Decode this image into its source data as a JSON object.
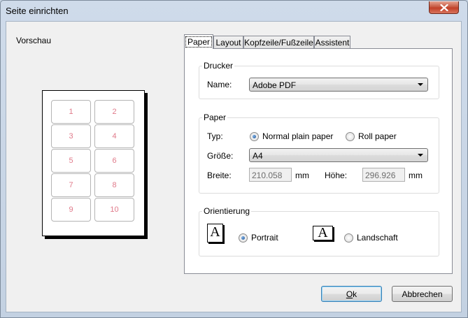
{
  "window": {
    "title": "Seite einrichten"
  },
  "preview": {
    "label": "Vorschau",
    "labels": [
      "1",
      "2",
      "3",
      "4",
      "5",
      "6",
      "7",
      "8",
      "9",
      "10"
    ]
  },
  "tabs": [
    {
      "label": "Paper",
      "active": true
    },
    {
      "label": "Layout",
      "active": false
    },
    {
      "label": "Kopfzeile/Fußzeile",
      "active": false
    },
    {
      "label": "Assistent",
      "active": false
    }
  ],
  "printer_group": {
    "title": "Drucker",
    "name_label": "Name:",
    "name_value": "Adobe PDF"
  },
  "paper_group": {
    "title": "Paper",
    "type_label": "Typ:",
    "type_normal": "Normal plain paper",
    "type_roll": "Roll paper",
    "selected_type": "Normal plain paper",
    "size_label": "Größe:",
    "size_value": "A4",
    "width_label": "Breite:",
    "width_value": "210.058",
    "width_unit": "mm",
    "height_label": "Höhe:",
    "height_value": "296.926",
    "height_unit": "mm"
  },
  "orientation_group": {
    "title": "Orientierung",
    "portrait": "Portrait",
    "landscape": "Landschaft",
    "selected": "Portrait",
    "icon_letter": "A"
  },
  "buttons": {
    "ok_prefix": "O",
    "ok_rest": "k",
    "cancel": "Abbrechen"
  },
  "colors": {
    "close_button": "#c75a42",
    "label_number": "#e07a8a"
  }
}
